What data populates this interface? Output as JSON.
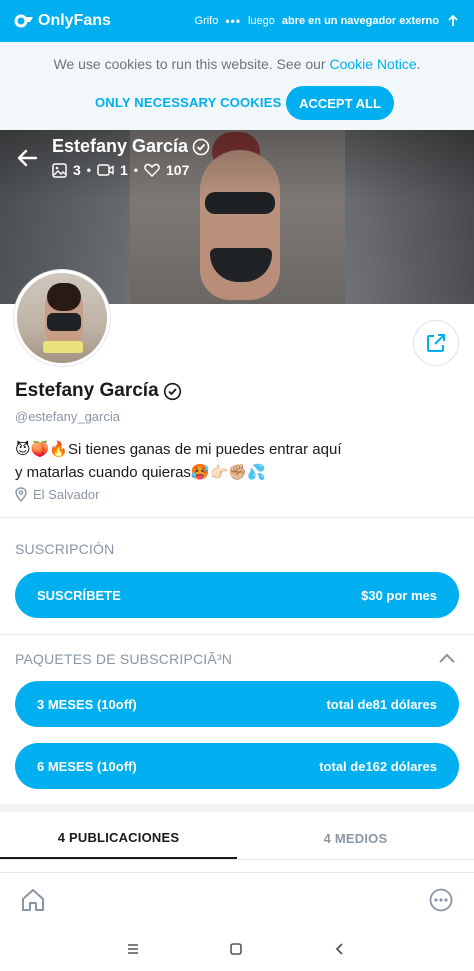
{
  "topbar": {
    "brand": "OnlyFans",
    "browser_name": "Grifo",
    "menu_dots": "•••",
    "then": "luego",
    "open_external": "abre en un navegador externo",
    "bg_color": "#00aff0"
  },
  "cookie_banner": {
    "text": "We use cookies to run this website. See our ",
    "link": "Cookie Notice",
    "period": ".",
    "only_necessary": "ONLY NECESSARY COOKIES",
    "accept_all": "ACCEPT ALL"
  },
  "cover": {
    "name": "Estefany García",
    "photos_count": "3",
    "videos_count": "1",
    "likes_count": "107",
    "dot": "•"
  },
  "profile": {
    "name": "Estefany García",
    "username": "@estefany_garcia",
    "bio_line1": "😈🍑🔥Si tienes ganas de mi puedes entrar aquí",
    "bio_line2": "y matarlas cuando quieras🥵👉🏻✊🏼💦",
    "location": "El Salvador"
  },
  "subscription": {
    "title": "SUSCRIPCIÓN",
    "subscribe_label": "SUSCRÍBETE",
    "subscribe_price": "$30 por mes"
  },
  "bundles": {
    "title": "PAQUETES DE SUBSCRIPCIÃ³N",
    "items": [
      {
        "label": "3 MESES (10off)",
        "price": "total de81 dólares"
      },
      {
        "label": "6 MESES (10off)",
        "price": "total de162 dólares"
      }
    ]
  },
  "tabs": {
    "posts": "4 PUBLICACIONES",
    "media": "4 MEDIOS"
  },
  "icons": {
    "back": "arrow-left-icon",
    "verified": "verified-badge-icon",
    "image": "image-icon",
    "video": "video-icon",
    "heart": "heart-icon",
    "share": "share-icon",
    "location": "location-pin-icon",
    "chevron": "chevron-up-icon",
    "home": "home-icon",
    "more": "more-icon"
  }
}
